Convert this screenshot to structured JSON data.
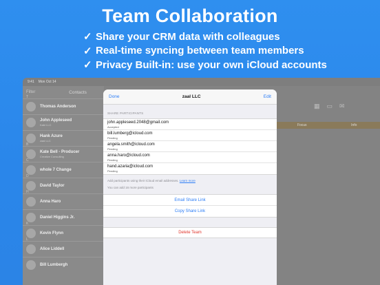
{
  "headline": "Team Collaboration",
  "bullets": [
    {
      "check": "✓",
      "text": "Share your CRM data with colleagues"
    },
    {
      "check": "✓",
      "text": "Real-time syncing between team members"
    },
    {
      "check": "✓",
      "text": "Privacy Built-in: use your own iCloud accounts"
    }
  ],
  "status": {
    "time": "9:41",
    "date": "Mon Oct 14"
  },
  "sidebar": {
    "filter": "Filter",
    "title": "Contacts",
    "contacts": [
      {
        "letter": "T",
        "name": "Thomas Anderson",
        "sub": ""
      },
      {
        "letter": "",
        "name": "John Appleseed",
        "sub": "Kabi LLC"
      },
      {
        "letter": "",
        "name": "Hank Azure",
        "sub": "zaal LLC"
      },
      {
        "letter": "B",
        "name": "Kate Bell - Producer",
        "sub": "Creative Consulting"
      },
      {
        "letter": "C",
        "name": "whole 7 Change",
        "sub": ""
      },
      {
        "letter": "D",
        "name": "David Taylor",
        "sub": ""
      },
      {
        "letter": "H",
        "name": "Anna Haro",
        "sub": ""
      },
      {
        "letter": "",
        "name": "Daniel Higgins Jr.",
        "sub": ""
      },
      {
        "letter": "K",
        "name": "Kevin Flynn",
        "sub": ""
      },
      {
        "letter": "L",
        "name": "Alice Liddell",
        "sub": ""
      },
      {
        "letter": "",
        "name": "Bill Lumbergh",
        "sub": ""
      }
    ]
  },
  "rightbar": {
    "left_tab": "Focus",
    "right_tab": "Info"
  },
  "modal": {
    "done": "Done",
    "title": "zaal LLC",
    "edit": "Edit",
    "section_label": "SHARE PARTICIPANTS",
    "participants": [
      {
        "email": "john.appleseed.2048@gmail.com",
        "status": "Accepted"
      },
      {
        "email": "bill.lumberg@icloud.com",
        "status": "Pending"
      },
      {
        "email": "angela.smith@icloud.com",
        "status": "Pending"
      },
      {
        "email": "anna.haro@icloud.com",
        "status": "Pending"
      },
      {
        "email": "hand.azaria@icloud.com",
        "status": "Pending"
      }
    ],
    "footer_text": "Add participants using their iCloud email addresses.",
    "footer_link": "Learn more",
    "footer_count": "You can add 16 more participants",
    "email_link": "Email Share Link",
    "copy_link": "Copy Share Link",
    "delete": "Delete Team"
  }
}
